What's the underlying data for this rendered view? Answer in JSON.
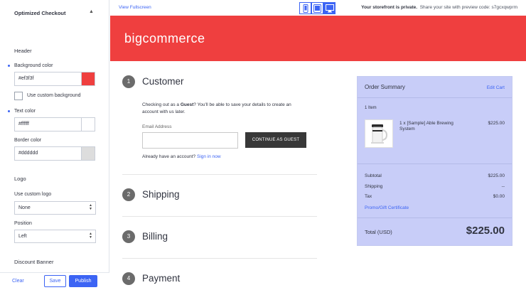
{
  "panel": {
    "title": "Optimized Checkout",
    "header_section": "Header",
    "bg_color_label": "Background color",
    "bg_color_value": "#ef3f3f",
    "use_custom_bg_label": "Use custom background",
    "text_color_label": "Text color",
    "text_color_value": "#ffffff",
    "border_color_label": "Border color",
    "border_color_value": "#dddddd",
    "logo_section": "Logo",
    "use_custom_logo_label": "Use custom logo",
    "use_custom_logo_value": "None",
    "position_label": "Position",
    "position_value": "Left",
    "discount_banner_section": "Discount Banner",
    "clear_label": "Clear",
    "save_label": "Save",
    "publish_label": "Publish"
  },
  "toolbar": {
    "fullscreen_label": "View Fullscreen",
    "private_bold": "Your storefront is private.",
    "private_text": "Share your site with preview code: s7gcxqwprm"
  },
  "preview": {
    "brand": "bigcommerce",
    "steps": [
      {
        "num": "1",
        "title": "Customer"
      },
      {
        "num": "2",
        "title": "Shipping"
      },
      {
        "num": "3",
        "title": "Billing"
      },
      {
        "num": "4",
        "title": "Payment"
      }
    ],
    "guest_pre": "Checking out as a ",
    "guest_bold": "Guest",
    "guest_post": "? You'll be able to save your details to create an account with us later.",
    "email_label": "Email Address",
    "guest_button": "CONTINUE AS GUEST",
    "have_account": "Already have an account?",
    "sign_in": "Sign in now"
  },
  "summary": {
    "title": "Order Summary",
    "edit_cart": "Edit Cart",
    "item_count": "1 Item",
    "product_name": "1 x [Sample] Able Brewing System",
    "product_price": "$225.00",
    "subtotal_label": "Subtotal",
    "subtotal_value": "$225.00",
    "shipping_label": "Shipping",
    "shipping_value": "--",
    "tax_label": "Tax",
    "tax_value": "$0.00",
    "promo": "Promo/Gift Certificate",
    "total_label": "Total (USD)",
    "total_value": "$225.00"
  },
  "colors": {
    "banner_bg": "#ef3f3f",
    "summary_bg": "#c8cdf8",
    "accent": "#3c64f4",
    "border_swatch": "#dddddd"
  },
  "icons": {
    "collapse": "chevron-up-icon",
    "devices": [
      "mobile-icon",
      "tablet-icon",
      "desktop-icon"
    ]
  }
}
